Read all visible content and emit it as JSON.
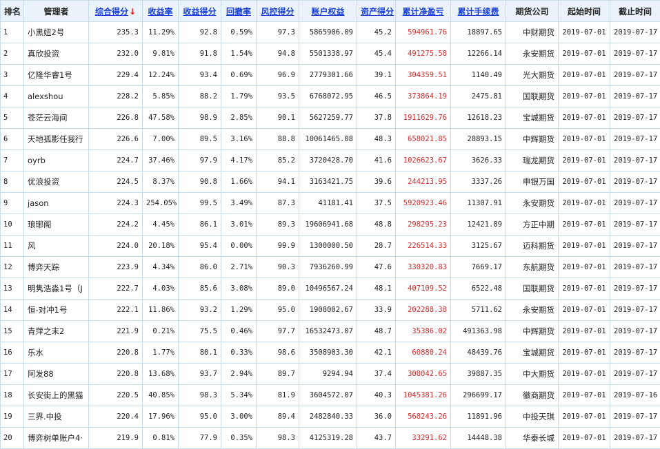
{
  "header": {
    "rank": "排名",
    "manager": "管理者",
    "total_score": "综合得分",
    "return_rate": "收益率",
    "return_score": "收益得分",
    "drawdown": "回撤率",
    "risk_score": "风控得分",
    "equity": "账户权益",
    "asset_score": "资产得分",
    "net_profit": "累计净盈亏",
    "fees": "累计手续费",
    "broker": "期货公司",
    "start": "起始时间",
    "end": "截止时间",
    "sort_arrow": "↓"
  },
  "colors": {
    "header_bg": "#eaf2fa",
    "border": "#c6dcea",
    "link": "#1a3fd6",
    "profit": "#d42a2a"
  },
  "rows": [
    {
      "rank": "1",
      "manager": "小黑妞2号",
      "total": "235.3",
      "rate": "11.29%",
      "rscore": "92.8",
      "dd": "0.59%",
      "risk": "97.3",
      "equity": "5865906.09",
      "asset": "45.2",
      "pnl": "594961.76",
      "fee": "18897.65",
      "broker": "中财期货",
      "start": "2019-07-01",
      "end": "2019-07-17"
    },
    {
      "rank": "2",
      "manager": "真欣投资",
      "total": "232.0",
      "rate": "9.81%",
      "rscore": "91.8",
      "dd": "1.54%",
      "risk": "94.8",
      "equity": "5501338.97",
      "asset": "45.4",
      "pnl": "491275.58",
      "fee": "12266.14",
      "broker": "永安期货",
      "start": "2019-07-01",
      "end": "2019-07-17"
    },
    {
      "rank": "3",
      "manager": "亿隆华睿1号",
      "total": "229.4",
      "rate": "12.24%",
      "rscore": "93.4",
      "dd": "0.69%",
      "risk": "96.9",
      "equity": "2779301.66",
      "asset": "39.1",
      "pnl": "304359.51",
      "fee": "1140.49",
      "broker": "光大期货",
      "start": "2019-07-01",
      "end": "2019-07-17"
    },
    {
      "rank": "4",
      "manager": "alexshou",
      "total": "228.2",
      "rate": "5.85%",
      "rscore": "88.2",
      "dd": "1.79%",
      "risk": "93.5",
      "equity": "6768072.95",
      "asset": "46.5",
      "pnl": "373864.19",
      "fee": "2475.81",
      "broker": "国联期货",
      "start": "2019-07-01",
      "end": "2019-07-17"
    },
    {
      "rank": "5",
      "manager": "苍茫云海间",
      "total": "226.8",
      "rate": "47.58%",
      "rscore": "98.9",
      "dd": "2.85%",
      "risk": "90.1",
      "equity": "5627259.77",
      "asset": "37.8",
      "pnl": "1911629.76",
      "fee": "12618.23",
      "broker": "宝城期货",
      "start": "2019-07-01",
      "end": "2019-07-17"
    },
    {
      "rank": "6",
      "manager": "天地孤影任我行",
      "total": "226.6",
      "rate": "7.00%",
      "rscore": "89.5",
      "dd": "3.16%",
      "risk": "88.8",
      "equity": "10061465.08",
      "asset": "48.3",
      "pnl": "658021.85",
      "fee": "28893.15",
      "broker": "中辉期货",
      "start": "2019-07-01",
      "end": "2019-07-17"
    },
    {
      "rank": "7",
      "manager": "oyrb",
      "total": "224.7",
      "rate": "37.46%",
      "rscore": "97.9",
      "dd": "4.17%",
      "risk": "85.2",
      "equity": "3720428.70",
      "asset": "41.6",
      "pnl": "1026623.67",
      "fee": "3626.33",
      "broker": "瑞龙期货",
      "start": "2019-07-01",
      "end": "2019-07-17"
    },
    {
      "rank": "8",
      "manager": "优浪投资",
      "total": "224.5",
      "rate": "8.37%",
      "rscore": "90.8",
      "dd": "1.66%",
      "risk": "94.1",
      "equity": "3163421.75",
      "asset": "39.6",
      "pnl": "244213.95",
      "fee": "3337.26",
      "broker": "申银万国",
      "start": "2019-07-01",
      "end": "2019-07-17"
    },
    {
      "rank": "9",
      "manager": "jason",
      "total": "224.3",
      "rate": "254.05%",
      "rscore": "99.5",
      "dd": "3.49%",
      "risk": "87.3",
      "equity": "41181.41",
      "asset": "37.5",
      "pnl": "5920923.46",
      "fee": "11307.91",
      "broker": "永安期货",
      "start": "2019-07-01",
      "end": "2019-07-17"
    },
    {
      "rank": "10",
      "manager": "琅琊阁",
      "total": "224.2",
      "rate": "4.45%",
      "rscore": "86.1",
      "dd": "3.01%",
      "risk": "89.3",
      "equity": "19606941.68",
      "asset": "48.8",
      "pnl": "298295.23",
      "fee": "12421.89",
      "broker": "方正中期",
      "start": "2019-07-01",
      "end": "2019-07-17"
    },
    {
      "rank": "11",
      "manager": "风",
      "total": "224.0",
      "rate": "20.18%",
      "rscore": "95.4",
      "dd": "0.00%",
      "risk": "99.9",
      "equity": "1300000.50",
      "asset": "28.7",
      "pnl": "226514.33",
      "fee": "3125.67",
      "broker": "迈科期货",
      "start": "2019-07-01",
      "end": "2019-07-17"
    },
    {
      "rank": "12",
      "manager": "博弈天踪",
      "total": "223.9",
      "rate": "4.34%",
      "rscore": "86.0",
      "dd": "2.71%",
      "risk": "90.3",
      "equity": "7936260.99",
      "asset": "47.6",
      "pnl": "330320.83",
      "fee": "7669.17",
      "broker": "东航期货",
      "start": "2019-07-01",
      "end": "2019-07-17"
    },
    {
      "rank": "13",
      "manager": "明隽浩淼1号（J",
      "total": "222.7",
      "rate": "4.03%",
      "rscore": "85.6",
      "dd": "3.08%",
      "risk": "89.0",
      "equity": "10496567.24",
      "asset": "48.1",
      "pnl": "407109.52",
      "fee": "6522.48",
      "broker": "国联期货",
      "start": "2019-07-01",
      "end": "2019-07-17"
    },
    {
      "rank": "14",
      "manager": "恒-对冲1号",
      "total": "222.1",
      "rate": "11.86%",
      "rscore": "93.2",
      "dd": "1.29%",
      "risk": "95.0",
      "equity": "1908002.67",
      "asset": "33.9",
      "pnl": "202288.38",
      "fee": "5711.62",
      "broker": "永安期货",
      "start": "2019-07-01",
      "end": "2019-07-17"
    },
    {
      "rank": "15",
      "manager": "青萍之末2",
      "total": "221.9",
      "rate": "0.21%",
      "rscore": "75.5",
      "dd": "0.46%",
      "risk": "97.7",
      "equity": "16532473.07",
      "asset": "48.7",
      "pnl": "35386.02",
      "fee": "491363.98",
      "broker": "中辉期货",
      "start": "2019-07-01",
      "end": "2019-07-17"
    },
    {
      "rank": "16",
      "manager": "乐水",
      "total": "220.8",
      "rate": "1.77%",
      "rscore": "80.1",
      "dd": "0.33%",
      "risk": "98.6",
      "equity": "3508903.30",
      "asset": "42.1",
      "pnl": "60880.24",
      "fee": "48439.76",
      "broker": "宝城期货",
      "start": "2019-07-01",
      "end": "2019-07-17"
    },
    {
      "rank": "17",
      "manager": "阿发88",
      "total": "220.8",
      "rate": "13.68%",
      "rscore": "93.7",
      "dd": "2.94%",
      "risk": "89.7",
      "equity": "9294.94",
      "asset": "37.4",
      "pnl": "308042.65",
      "fee": "39887.35",
      "broker": "中大期货",
      "start": "2019-07-01",
      "end": "2019-07-17"
    },
    {
      "rank": "18",
      "manager": "长安街上的黑猫",
      "total": "220.5",
      "rate": "40.85%",
      "rscore": "98.3",
      "dd": "5.34%",
      "risk": "81.9",
      "equity": "3604572.07",
      "asset": "40.3",
      "pnl": "1045381.26",
      "fee": "296699.17",
      "broker": "徽商期货",
      "start": "2019-07-01",
      "end": "2019-07-16"
    },
    {
      "rank": "19",
      "manager": "三界.中投",
      "total": "220.4",
      "rate": "17.96%",
      "rscore": "95.0",
      "dd": "3.00%",
      "risk": "89.4",
      "equity": "2482840.33",
      "asset": "36.0",
      "pnl": "568243.26",
      "fee": "11891.96",
      "broker": "中投天琪",
      "start": "2019-07-01",
      "end": "2019-07-17"
    },
    {
      "rank": "20",
      "manager": "博弈树单账户4·",
      "total": "219.9",
      "rate": "0.81%",
      "rscore": "77.9",
      "dd": "0.35%",
      "risk": "98.3",
      "equity": "4125319.28",
      "asset": "43.7",
      "pnl": "33291.62",
      "fee": "14448.38",
      "broker": "华泰长城",
      "start": "2019-07-01",
      "end": "2019-07-17"
    }
  ]
}
